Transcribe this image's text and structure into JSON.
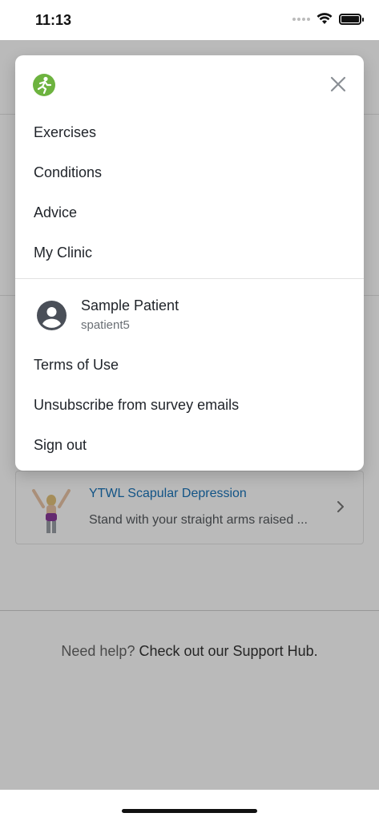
{
  "status_bar": {
    "time": "11:13"
  },
  "menu": {
    "nav_items": [
      {
        "label": "Exercises"
      },
      {
        "label": "Conditions"
      },
      {
        "label": "Advice"
      },
      {
        "label": "My Clinic"
      }
    ],
    "user": {
      "name": "Sample Patient",
      "username": "spatient5"
    },
    "account_items": [
      {
        "label": "Terms of Use"
      },
      {
        "label": "Unsubscribe from survey emails"
      },
      {
        "label": "Sign out"
      }
    ],
    "icons": {
      "logo": "runner-logo-icon",
      "close": "close-icon",
      "avatar": "avatar-icon"
    },
    "colors": {
      "logo": "#6db33f"
    }
  },
  "background": {
    "exercise_card": {
      "title": "YTWL Scapular Depression",
      "description": "Stand with your straight arms raised ...",
      "colors": {
        "title": "#1a73b8"
      }
    },
    "support": {
      "prefix": "Need help?",
      "link": "Check out our Support Hub."
    }
  }
}
